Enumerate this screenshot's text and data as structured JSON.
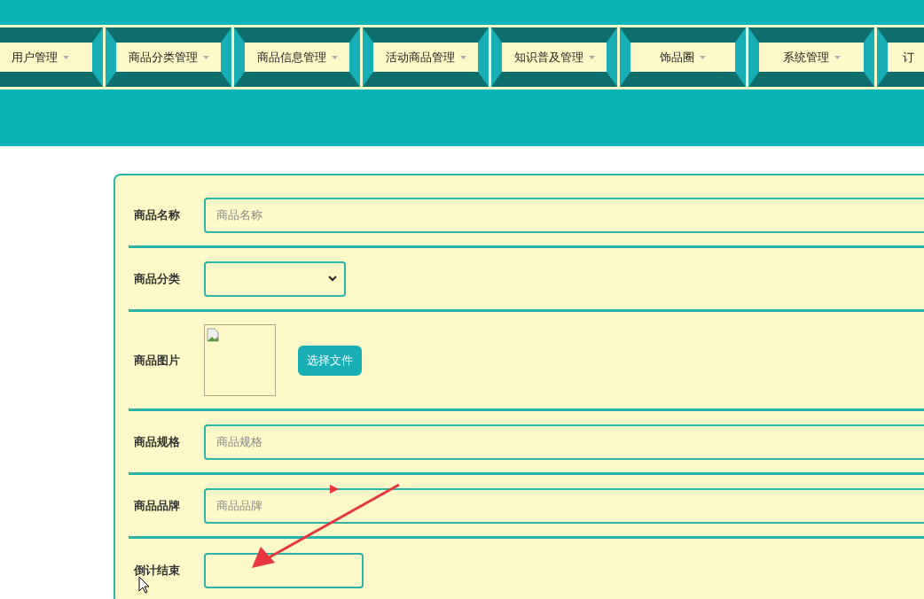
{
  "menu": [
    {
      "label": "用户管理",
      "has_dropdown": true
    },
    {
      "label": "商品分类管理",
      "has_dropdown": true
    },
    {
      "label": "商品信息管理",
      "has_dropdown": true
    },
    {
      "label": "活动商品管理",
      "has_dropdown": true
    },
    {
      "label": "知识普及管理",
      "has_dropdown": true
    },
    {
      "label": "饰品圈",
      "has_dropdown": true
    },
    {
      "label": "系统管理",
      "has_dropdown": true
    },
    {
      "label": "订",
      "has_dropdown": false
    }
  ],
  "form": {
    "rows": [
      {
        "kind": "text",
        "label": "商品名称",
        "placeholder": "商品名称"
      },
      {
        "kind": "select",
        "label": "商品分类"
      },
      {
        "kind": "image",
        "label": "商品图片",
        "button": "选择文件"
      },
      {
        "kind": "text",
        "label": "商品规格",
        "placeholder": "商品规格"
      },
      {
        "kind": "text",
        "label": "商品品牌",
        "placeholder": "商品品牌"
      },
      {
        "kind": "short",
        "label": "倒计结束"
      }
    ]
  }
}
